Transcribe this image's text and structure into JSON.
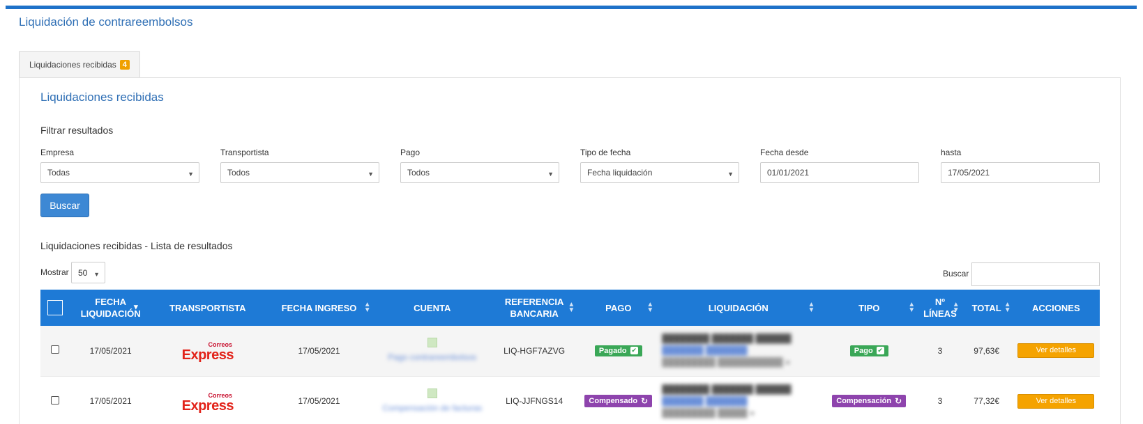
{
  "page": {
    "title": "Liquidación de contrareembolsos"
  },
  "tabs": [
    {
      "label": "Liquidaciones recibidas",
      "badge": "4"
    }
  ],
  "panel": {
    "title": "Liquidaciones recibidas"
  },
  "filters": {
    "title": "Filtrar resultados",
    "empresa": {
      "label": "Empresa",
      "value": "Todas"
    },
    "transportista": {
      "label": "Transportista",
      "value": "Todos"
    },
    "pago": {
      "label": "Pago",
      "value": "Todos"
    },
    "tipo_fecha": {
      "label": "Tipo de fecha",
      "value": "Fecha liquidación"
    },
    "fecha_desde": {
      "label": "Fecha desde",
      "value": "01/01/2021"
    },
    "hasta": {
      "label": "hasta",
      "value": "17/05/2021"
    },
    "search_button": "Buscar"
  },
  "results": {
    "title": "Liquidaciones recibidas - Lista de resultados",
    "show_label": "Mostrar",
    "show_value": "50",
    "search_label": "Buscar",
    "columns": {
      "fecha_liq_1": "FECHA",
      "fecha_liq_2": "LIQUIDACIÓN",
      "transportista": "TRANSPORTISTA",
      "fecha_ingreso": "FECHA INGRESO",
      "cuenta": "CUENTA",
      "ref_1": "REFERENCIA",
      "ref_2": "BANCARIA",
      "pago": "PAGO",
      "liquidacion": "LIQUIDACIÓN",
      "tipo": "TIPO",
      "lineas_1": "Nº",
      "lineas_2": "LÍNEAS",
      "total": "TOTAL",
      "acciones": "ACCIONES"
    },
    "rows": [
      {
        "fecha_liquidacion": "17/05/2021",
        "transportista_logo_small": "Correos",
        "transportista_logo_big": "Express",
        "fecha_ingreso": "17/05/2021",
        "cuenta": "Pago contrareembolsos",
        "referencia": "LIQ-HGF7AZVG",
        "pago": "Pagado",
        "pago_icon": "check-icon",
        "tipo": "Pago",
        "tipo_icon": "check-icon",
        "lineas": "3",
        "total": "97,63€",
        "action": "Ver detalles"
      },
      {
        "fecha_liquidacion": "17/05/2021",
        "transportista_logo_small": "Correos",
        "transportista_logo_big": "Express",
        "fecha_ingreso": "17/05/2021",
        "cuenta": "Compensación de facturas",
        "referencia": "LIQ-JJFNGS14",
        "pago": "Compensado",
        "pago_icon": "refresh-icon",
        "tipo": "Compensación",
        "tipo_icon": "refresh-icon",
        "lineas": "3",
        "total": "77,32€",
        "action": "Ver detalles"
      }
    ]
  },
  "colors": {
    "accent": "#1e7ad6",
    "success": "#3aa757",
    "warning": "#f5a300",
    "purple": "#8e44ad"
  }
}
